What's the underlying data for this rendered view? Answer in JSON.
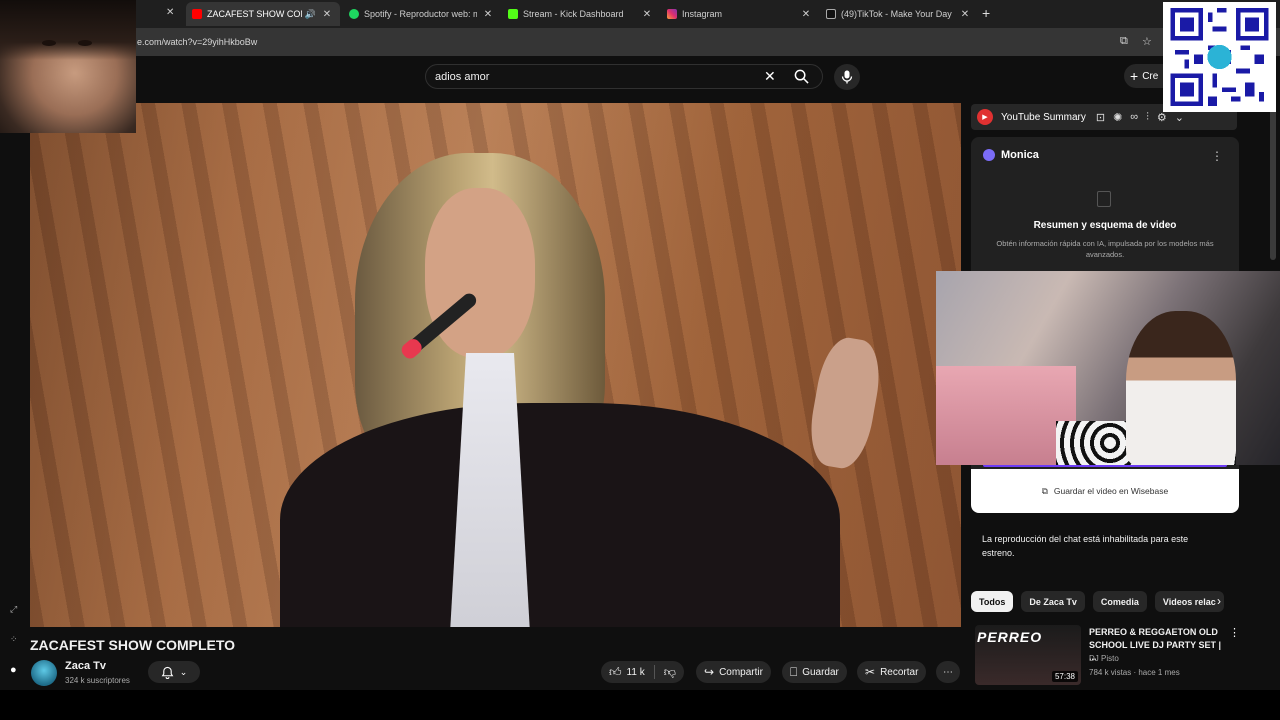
{
  "browser": {
    "tabs": [
      {
        "label": "ZACAFEST SHOW COMPLETO",
        "active": true,
        "icon": "youtube-icon",
        "color": "#ff0000"
      },
      {
        "label": "Spotify - Reproductor web: mú",
        "icon": "spotify-icon",
        "color": "#1ed760"
      },
      {
        "label": "Stream - Kick Dashboard",
        "icon": "kick-icon",
        "color": "#53fc18"
      },
      {
        "label": "Instagram",
        "icon": "instagram-icon",
        "color": "#e1306c"
      },
      {
        "label": "(49)TikTok - Make Your Day",
        "icon": "tiktok-icon",
        "color": "#ffffff"
      }
    ],
    "new_tab": "+",
    "url": "e.com/watch?v=29yihHkboBw"
  },
  "header": {
    "search_value": "adios amor",
    "create_label": "Cre"
  },
  "video": {
    "title": "ZACAFEST SHOW COMPLETO",
    "channel": "Zaca Tv",
    "subscribers": "324 k suscriptores",
    "likes": "11 k",
    "share": "Compartir",
    "save": "Guardar",
    "clip": "Recortar"
  },
  "extension": {
    "summary_title": "YouTube Summary",
    "monica_title": "Monica",
    "heading": "Resumen y esquema de video",
    "description": "Obtén información rápida con IA, impulsada por los modelos más avanzados.",
    "save_label": "Guardar el video en Wisebase"
  },
  "chat_disabled": "La reproducción del chat está inhabilitada para este estreno.",
  "chips": [
    "Todos",
    "De Zaca Tv",
    "Comedia",
    "Videos relac"
  ],
  "recommendation": {
    "thumb_text": "PERREO",
    "title": "PERREO & REGGAETON OLD SCHOOL LIVE DJ PARTY SET | ...",
    "channel": "DJ Pisto",
    "meta": "784 k vistas · hace 1 mes",
    "duration": "57:38"
  },
  "colors": {
    "background": "#0f0f0f",
    "youtube_red": "#ff0000",
    "monica_purple": "#6d3cf5"
  }
}
